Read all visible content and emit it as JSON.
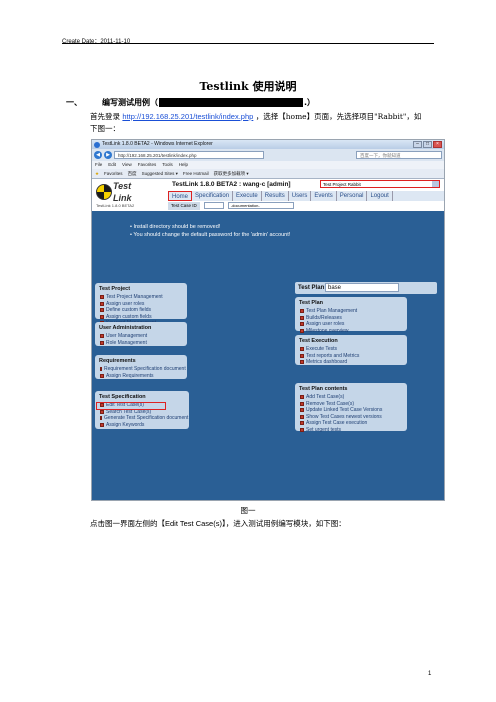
{
  "header": {
    "create_date": "Create Date：2011-11-10"
  },
  "title": "Testlink 使用说明",
  "section1": {
    "number": "一、",
    "label_pre": "编写测试用例（",
    "label_post": ".）"
  },
  "para1": {
    "prefix": "首先登录",
    "url": "http://192.168.25.201/testlink/index.php",
    "suffix": "，选择【home】页面，先选择项目\"Rabbit\"，如下图一："
  },
  "ie": {
    "window_title": "TestLink 1.8.0 BETA2 - Windows Internet Explorer",
    "address": "http://192.168.25.201/testlink/index.php",
    "search_placeholder": "百度一下，你就知道",
    "menu": [
      "File",
      "Edit",
      "View",
      "Favorites",
      "Tools",
      "Help"
    ],
    "favorites": [
      "Favorites",
      "百度",
      "Suggested Sites ▾",
      "Free Hotmail",
      "获取更多加载项 ▾"
    ],
    "tab_label": "TestLink 1.8.0 BETA2",
    "page_tools": [
      "Page ▾",
      "Safety ▾",
      "Tools ▾"
    ]
  },
  "testlink": {
    "logo_top": "Test",
    "logo_bottom": "Link",
    "logo_version": "TestLink 1.8.0 BETA2",
    "header_name": "TestLink 1.8.0 BETA2 : wang-c [admin]",
    "project_select": "Test Project  Rabbit",
    "nav": [
      "Home",
      "Specification",
      "Execute",
      "Results",
      "Users",
      "Events",
      "Personal",
      "Logout"
    ],
    "testcase_label": "Test Case ID",
    "doc_select": "-documentation-",
    "warnings": [
      "Install directory should be removed!",
      "You should change the default password for the 'admin' account!"
    ],
    "test_plan_label": "Test Plan",
    "test_plan_value": "base",
    "left_panels": [
      {
        "title": "Test Project",
        "items": [
          "Test Project Management",
          "Assign user roles",
          "Define custom fields",
          "Assign custom fields",
          "Keyword Management"
        ]
      },
      {
        "title": "User Administration",
        "items": [
          "User Management",
          "Role Management"
        ]
      },
      {
        "title": "Requirements",
        "items": [
          "Requirement Specification document",
          "Assign Requirements"
        ]
      },
      {
        "title": "Test Specification",
        "items": [
          "Edit Test Case(s)",
          "Search Test Case(s)",
          "Generate Test Specification document",
          "Assign Keywords"
        ]
      }
    ],
    "right_panels": [
      {
        "title": "Test Plan",
        "items": [
          "Test Plan Management",
          "Builds/Releases",
          "Assign user roles",
          "Milestone overview"
        ]
      },
      {
        "title": "Test Execution",
        "items": [
          "Execute Tests",
          "Test reports and Metrics",
          "Metrics dashboard"
        ]
      },
      {
        "title": "Test Plan contents",
        "items": [
          "Add Test Case(s)",
          "Remove Test Case(s)",
          "Update Linked Test Case Versions",
          "Show Test Cases newest versions",
          "Assign Test Case execution",
          "Set urgent tests"
        ]
      }
    ]
  },
  "caption": "图一",
  "para2": {
    "prefix": "点击图一界面左侧的【",
    "keyword": "Edit Test Case(s)",
    "suffix": "】，进入测试用例编写模块，如下图："
  },
  "page_number": "1"
}
